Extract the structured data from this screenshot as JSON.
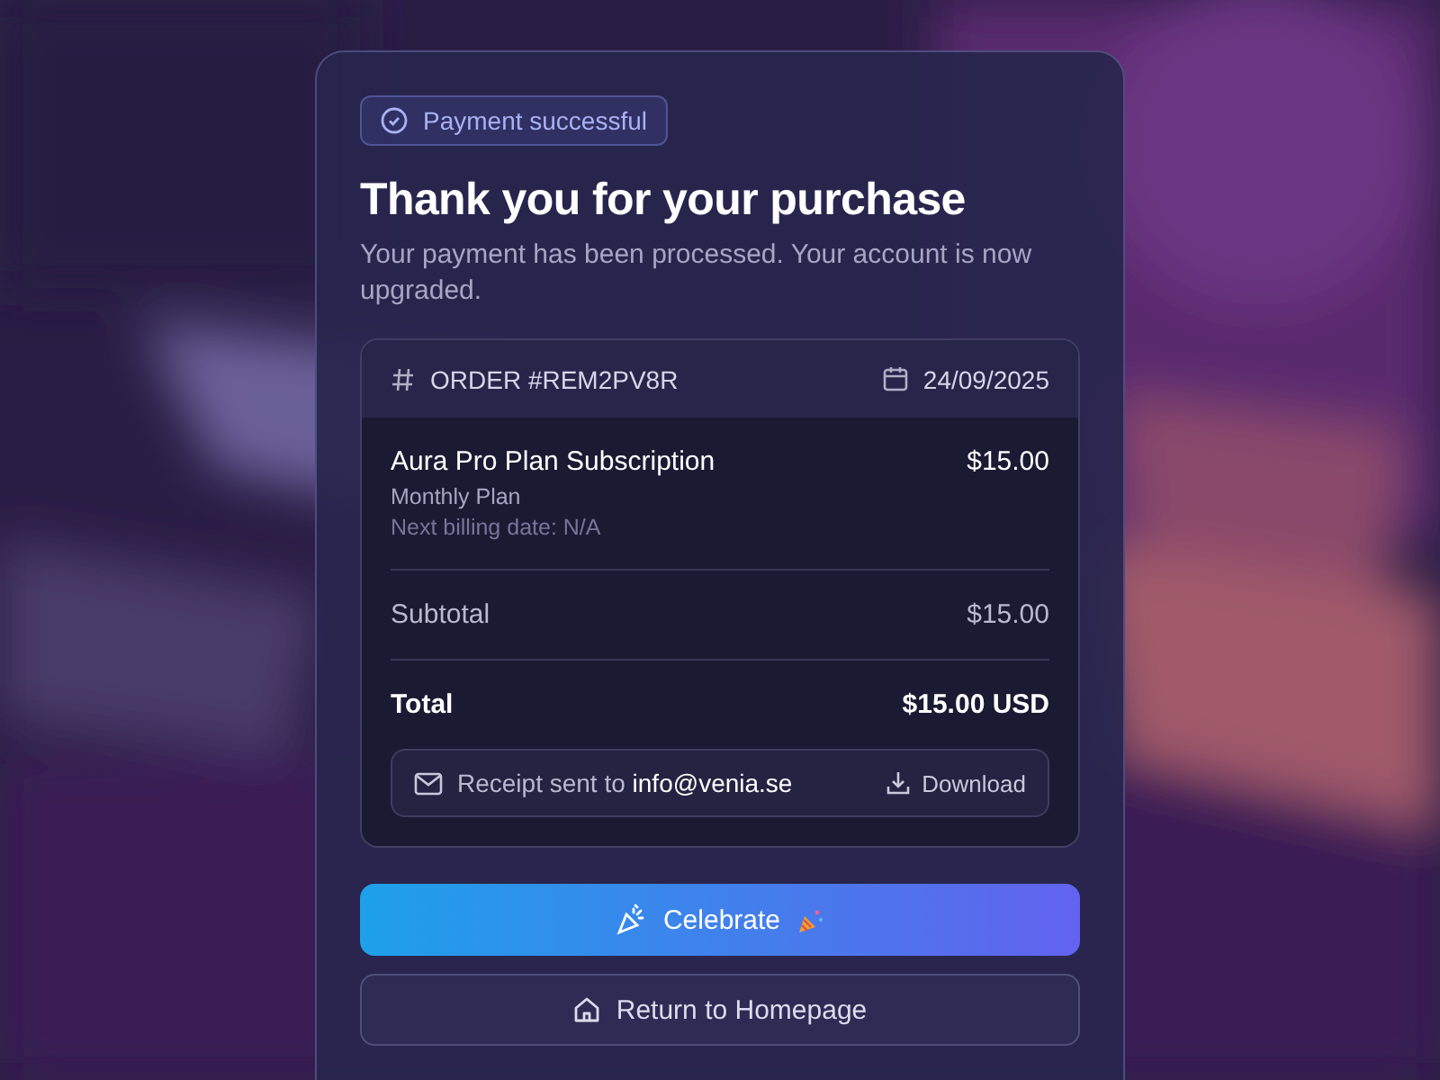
{
  "badge": {
    "label": "Payment successful"
  },
  "title": "Thank you for your purchase",
  "subtitle": "Your payment has been processed. Your account is now upgraded.",
  "order": {
    "number": "ORDER #REM2PV8R",
    "date": "24/09/2025",
    "item": {
      "name": "Aura Pro Plan Subscription",
      "price": "$15.00",
      "plan": "Monthly Plan",
      "billing": "Next billing date: N/A"
    },
    "subtotal": {
      "label": "Subtotal",
      "value": "$15.00"
    },
    "total": {
      "label": "Total",
      "value": "$15.00 USD"
    },
    "receipt": {
      "text": "Receipt sent to **info@venia.se**",
      "action": "Download"
    }
  },
  "buttons": [
    {
      "kind": "primary",
      "label": "Celebrate"
    },
    {
      "kind": "secondary",
      "label": "Return to Homepage"
    }
  ]
}
